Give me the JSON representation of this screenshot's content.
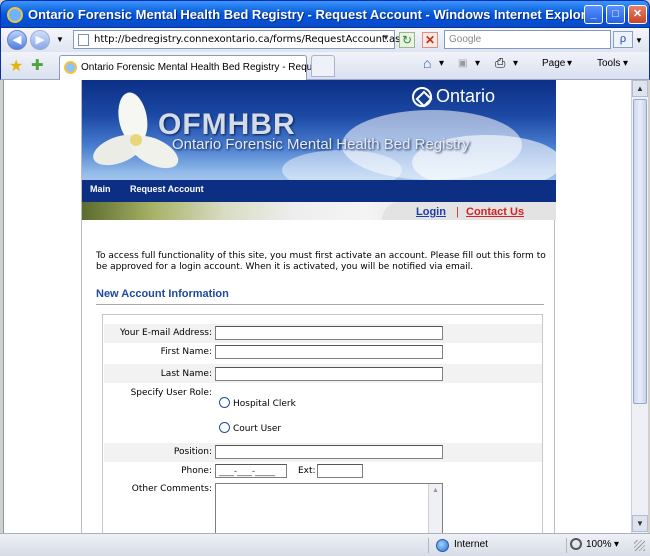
{
  "window": {
    "title": "Ontario Forensic Mental Health Bed Registry - Request Account - Windows Internet Explorer",
    "minimize": "_",
    "maximize": "□",
    "close": "✕"
  },
  "toolbar": {
    "back": "◀",
    "forward": "▶",
    "history_drop": "▼",
    "url": "http://bedregistry.connexontario.ca/forms/RequestAccount.aspx",
    "refresh": "↻",
    "stop": "✕",
    "search_placeholder": "Google",
    "search_go": "ρ"
  },
  "tabs": {
    "active_label": "Ontario Forensic Mental Health Bed Registry - Reques...",
    "favorites": "★",
    "add_favorites": "✚"
  },
  "commands": {
    "home": "⌂",
    "feeds": "▣",
    "print": "⎙",
    "page": "Page",
    "tools": "Tools",
    "drop": "▾"
  },
  "banner": {
    "ontario": "Ontario",
    "acronym": "OFMHBR",
    "fullname": "Ontario Forensic Mental Health Bed Registry"
  },
  "nav": {
    "main": "Main",
    "request_account": "Request Account"
  },
  "links": {
    "login": "Login",
    "separator": "|",
    "contact": "Contact Us"
  },
  "intro": "To access full functionality of this site, you must first activate an account. Please fill out this form to be approved for a login account. When it is activated, you will be notified via email.",
  "section_title": "New Account Information",
  "form": {
    "email_label": "Your E-mail Address:",
    "first_name_label": "First Name:",
    "last_name_label": "Last Name:",
    "role_label": "Specify User Role:",
    "role_options": [
      "Hospital Clerk",
      "Court User"
    ],
    "position_label": "Position:",
    "phone_label": "Phone:",
    "phone_mask": "___-___-____",
    "ext_label": "Ext:",
    "comments_label": "Other Comments:"
  },
  "scroll": {
    "up": "▲",
    "down": "▼"
  },
  "status": {
    "zone": "Internet",
    "zoom": "100%",
    "zoom_drop": "▾"
  }
}
